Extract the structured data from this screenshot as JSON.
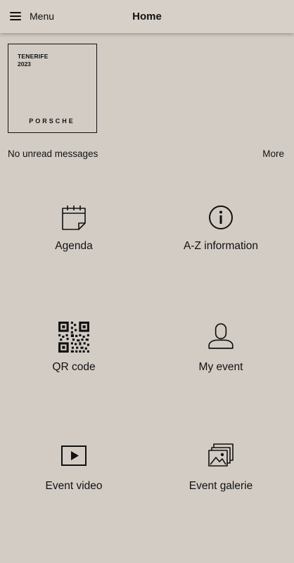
{
  "header": {
    "menu_label": "Menu",
    "title": "Home"
  },
  "event": {
    "name": "TENERIFE",
    "year": "2023",
    "brand": "PORSCHE"
  },
  "messages": {
    "status": "No unread messages",
    "more_label": "More"
  },
  "tiles": [
    {
      "label": "Agenda",
      "icon": "calendar-icon"
    },
    {
      "label": "A-Z information",
      "icon": "info-icon"
    },
    {
      "label": "QR code",
      "icon": "qr-code-icon"
    },
    {
      "label": "My event",
      "icon": "person-icon"
    },
    {
      "label": "Event video",
      "icon": "video-play-icon"
    },
    {
      "label": "Event galerie",
      "icon": "gallery-icon"
    }
  ],
  "colors": {
    "background": "#d3ccc5",
    "header": "#d6d0c8",
    "text": "#111111"
  }
}
